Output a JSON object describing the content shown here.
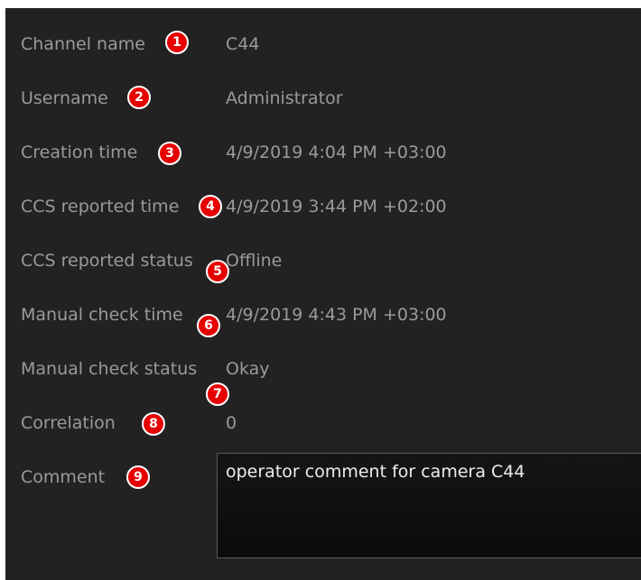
{
  "fields": [
    {
      "label": "Channel name",
      "value": "C44",
      "badge": "1"
    },
    {
      "label": "Username",
      "value": "Administrator",
      "badge": "2"
    },
    {
      "label": "Creation time",
      "value": "4/9/2019 4:04 PM +03:00",
      "badge": "3"
    },
    {
      "label": "CCS reported time",
      "value": "4/9/2019 3:44 PM +02:00",
      "badge": "4"
    },
    {
      "label": "CCS reported status",
      "value": "Offline",
      "badge": "5"
    },
    {
      "label": "Manual check time",
      "value": "4/9/2019 4:43 PM +03:00",
      "badge": "6"
    },
    {
      "label": "Manual check status",
      "value": "Okay",
      "badge": "7"
    },
    {
      "label": "Correlation",
      "value": "0",
      "badge": "8"
    }
  ],
  "comment": {
    "label": "Comment",
    "value": "operator comment for camera C44",
    "badge": "9"
  },
  "colors": {
    "panel_background": "#222222",
    "label_text": "#9a9a9a",
    "comment_text": "#ededed",
    "badge_fill": "#e60000"
  }
}
